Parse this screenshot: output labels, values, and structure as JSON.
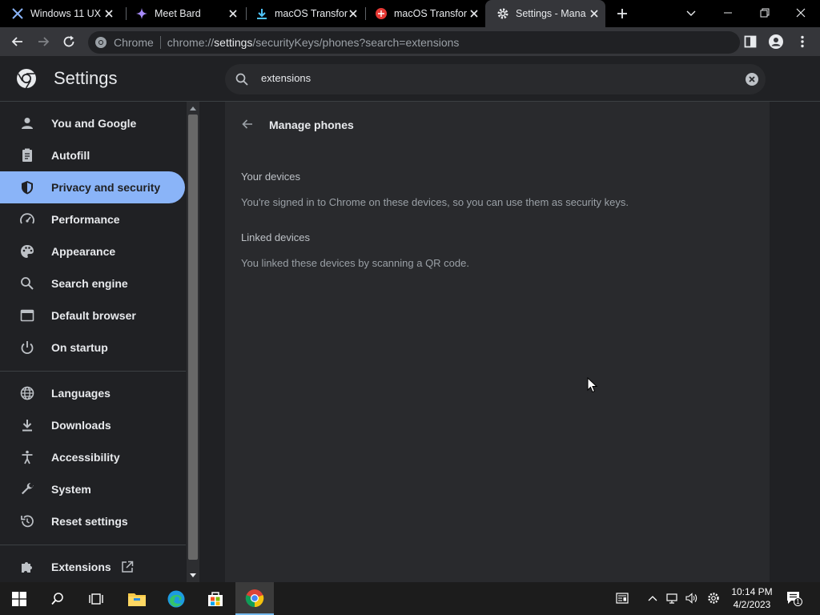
{
  "browser": {
    "tabs": [
      {
        "title": "Windows 11 UX",
        "active": false
      },
      {
        "title": "Meet Bard",
        "active": false
      },
      {
        "title": "macOS Transfor",
        "active": false
      },
      {
        "title": "macOS Transfor",
        "active": false
      },
      {
        "title": "Settings - Mana",
        "active": true
      }
    ],
    "omnibox": {
      "chip": "Chrome",
      "url_prefix": "chrome://",
      "url_host": "settings",
      "url_rest": "/securityKeys/phones?search=extensions"
    }
  },
  "header": {
    "title": "Settings",
    "search_value": "extensions"
  },
  "sidebar": {
    "items": [
      {
        "label": "You and Google",
        "icon": "person-icon"
      },
      {
        "label": "Autofill",
        "icon": "clipboard-icon"
      },
      {
        "label": "Privacy and security",
        "icon": "shield-icon",
        "selected": true
      },
      {
        "label": "Performance",
        "icon": "speedometer-icon"
      },
      {
        "label": "Appearance",
        "icon": "palette-icon"
      },
      {
        "label": "Search engine",
        "icon": "search-icon"
      },
      {
        "label": "Default browser",
        "icon": "browser-icon"
      },
      {
        "label": "On startup",
        "icon": "power-icon"
      },
      {
        "label": "Languages",
        "icon": "globe-icon"
      },
      {
        "label": "Downloads",
        "icon": "download-icon"
      },
      {
        "label": "Accessibility",
        "icon": "accessibility-icon"
      },
      {
        "label": "System",
        "icon": "wrench-icon"
      },
      {
        "label": "Reset settings",
        "icon": "reset-icon"
      },
      {
        "label": "Extensions",
        "icon": "puzzle-icon"
      }
    ]
  },
  "main": {
    "heading": "Manage phones",
    "sections": [
      {
        "title": "Your devices",
        "description": "You're signed in to Chrome on these devices, so you can use them as security keys."
      },
      {
        "title": "Linked devices",
        "description": "You linked these devices by scanning a QR code."
      }
    ]
  },
  "taskbar": {
    "time": "10:14 PM",
    "date": "4/2/2023",
    "notification_count": "1"
  },
  "colors": {
    "accent": "#8ab4f8",
    "background": "#202124",
    "card": "#292a2d",
    "toolbar": "#35363a"
  }
}
